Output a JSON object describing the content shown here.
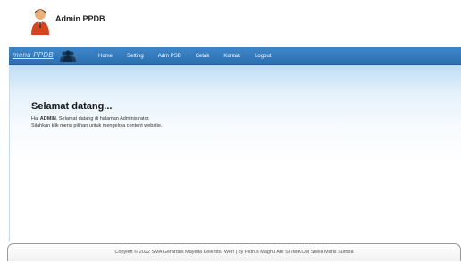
{
  "header": {
    "title": "Admin PPDB",
    "avatar_icon": "admin-user-icon"
  },
  "navbar": {
    "brand": "menu PPDB",
    "brand_icon": "users-group-icon",
    "items": [
      {
        "label": "Home"
      },
      {
        "label": "Setting"
      },
      {
        "label": "Adm PSB"
      },
      {
        "label": "Cetak"
      },
      {
        "label": "Kontak"
      },
      {
        "label": "Logout"
      }
    ]
  },
  "main": {
    "heading": "Selamat datang...",
    "greeting_prefix": "Hai",
    "username": "ADMIN",
    "greeting_suffix": ". Selamat datang di halaman Administrator.",
    "instruction": "Silahkan klik menu pilihan untuk mengelola content website."
  },
  "footer": {
    "text": "Copyleft © 2022 SMA Gerardus Mayella Kelembu Weri | by Petrus Maghu Ate STIMIKOM Stella Maris Sumba"
  },
  "colors": {
    "nav_bar": "#3173b4",
    "content_gradient_top": "#bfdcf4"
  }
}
